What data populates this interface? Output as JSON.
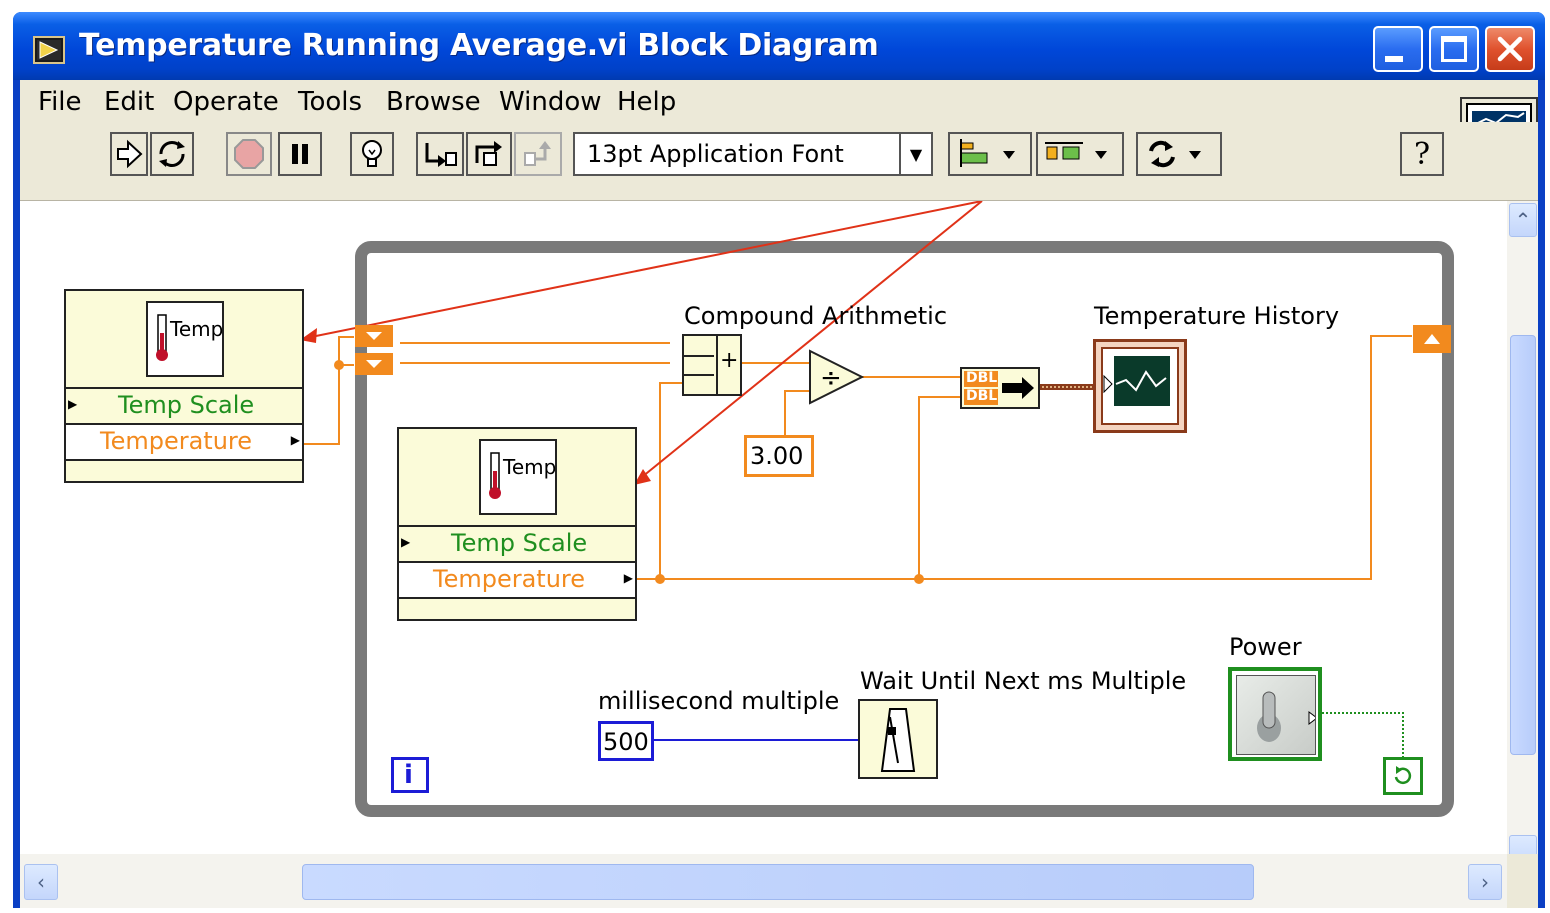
{
  "window": {
    "title": "Temperature Running Average.vi Block Diagram"
  },
  "menu": [
    "File",
    "Edit",
    "Operate",
    "Tools",
    "Browse",
    "Window",
    "Help"
  ],
  "toolbar": {
    "font_label": "13pt Application Font",
    "help_glyph": "?"
  },
  "diagram": {
    "subvi_label": "Temp",
    "terminal_temp_scale": "Temp Scale",
    "terminal_temperature": "Temperature",
    "compound_arithmetic_label": "Compound Arithmetic",
    "compound_plus": "+",
    "divide_glyph": "÷",
    "divisor_constant": "3.00",
    "chart_label": "Temperature History",
    "dbl_tag": "DBL",
    "ms_label": "millisecond multiple",
    "ms_value": "500",
    "wait_label": "Wait Until Next ms Multiple",
    "power_label": "Power",
    "iteration_glyph": "i"
  },
  "colors": {
    "titlebar": "#0047d9",
    "chrome": "#ece9d8",
    "wire_double": "#f28a1e",
    "wire_int": "#1c1cd6",
    "wire_bool": "#1f8f1f",
    "annotation_arrow": "#e03218",
    "loop_border": "#7a7a7a",
    "subvi_fill": "#fbfbd9"
  },
  "icons": [
    "run-arrow-icon",
    "run-continuous-icon",
    "abort-icon",
    "pause-icon",
    "highlight-execution-icon",
    "step-into-icon",
    "step-over-icon",
    "step-out-icon",
    "align-icon",
    "distribute-icon",
    "reorder-icon",
    "help-icon",
    "thermometer-icon",
    "metronome-icon",
    "toggle-switch-icon",
    "loop-condition-icon"
  ]
}
